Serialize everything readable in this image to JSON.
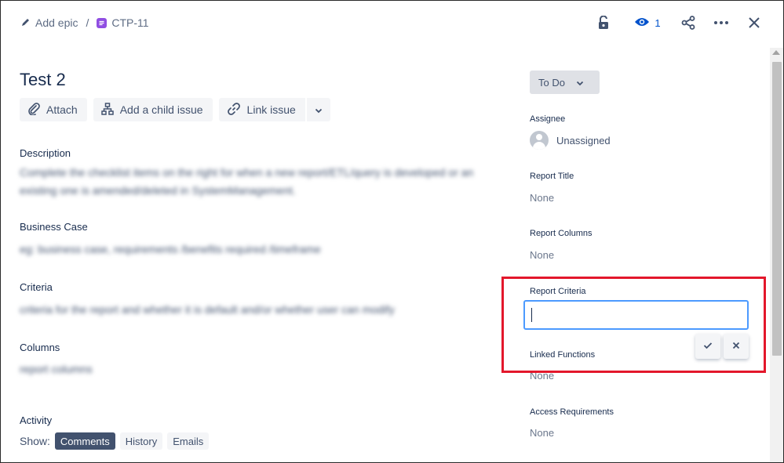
{
  "breadcrumb": {
    "add_epic": "Add epic",
    "separator": "/",
    "issue_key": "CTP-11"
  },
  "topbar": {
    "watch_count": "1",
    "icons": [
      "lock-icon",
      "eye-icon",
      "share-icon",
      "more-icon",
      "close-icon"
    ]
  },
  "issue": {
    "title": "Test 2"
  },
  "actions": {
    "attach": "Attach",
    "add_child": "Add a child issue",
    "link_issue": "Link issue"
  },
  "sections": {
    "description": {
      "heading": "Description",
      "line1": "Complete the checklist items on the right for when a new report/ETL/query is developed or an",
      "line2": "existing one is amended/deleted in SystemManagement."
    },
    "business_case": {
      "heading": "Business Case",
      "text": "eg: business case, requirements /benefits required /timeframe"
    },
    "criteria": {
      "heading": "Criteria",
      "text": "criteria for the report and whether it is default and/or whether user can modify"
    },
    "columns": {
      "heading": "Columns",
      "text": "report columns"
    }
  },
  "activity": {
    "heading": "Activity",
    "show_label": "Show:",
    "filters": [
      "Comments",
      "History",
      "Emails"
    ],
    "active_filter": "Comments"
  },
  "sidebar": {
    "status": "To Do",
    "assignee": {
      "label": "Assignee",
      "value": "Unassigned"
    },
    "report_title": {
      "label": "Report Title",
      "value": "None"
    },
    "report_columns": {
      "label": "Report Columns",
      "value": "None"
    },
    "report_criteria": {
      "label": "Report Criteria",
      "value": ""
    },
    "linked_functions": {
      "label": "Linked Functions",
      "value": "None"
    },
    "access_requirements": {
      "label": "Access Requirements",
      "value": "None"
    }
  },
  "colors": {
    "highlight": "#E3172B",
    "focus": "#4C9AFF",
    "story": "#904EE2",
    "watch": "#0052CC"
  }
}
